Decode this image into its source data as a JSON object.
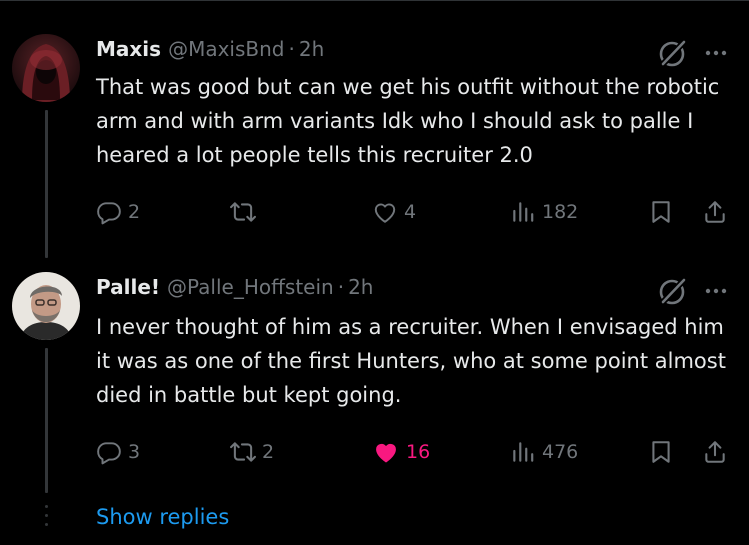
{
  "replies": [
    {
      "name": "Maxis",
      "handle": "@MaxisBnd",
      "separator": "·",
      "time": "2h",
      "text": "That was good but can we get his outfit without the robotic arm and with arm variants Idk who I should ask to palle I heared a lot people tells this recruiter 2.0",
      "reply_count": "2",
      "repost_count": "",
      "like_count": "4",
      "view_count": "182",
      "liked": false
    },
    {
      "name": "Palle!",
      "handle": "@Palle_Hoffstein",
      "separator": "·",
      "time": "2h",
      "text": "I never thought of him as a recruiter. When I envisaged him it was as one of the first Hunters, who at some point almost died in battle but kept going.",
      "reply_count": "3",
      "repost_count": "2",
      "like_count": "16",
      "view_count": "476",
      "liked": true
    }
  ],
  "show_replies_label": "Show replies",
  "colors": {
    "background": "#000000",
    "text": "#e7e9ea",
    "muted": "#71767b",
    "accent": "#1d9bf0",
    "like": "#f91880"
  },
  "icons": [
    "grok-icon",
    "more-icon",
    "reply-icon",
    "repost-icon",
    "like-icon",
    "views-icon",
    "bookmark-icon",
    "share-icon"
  ]
}
